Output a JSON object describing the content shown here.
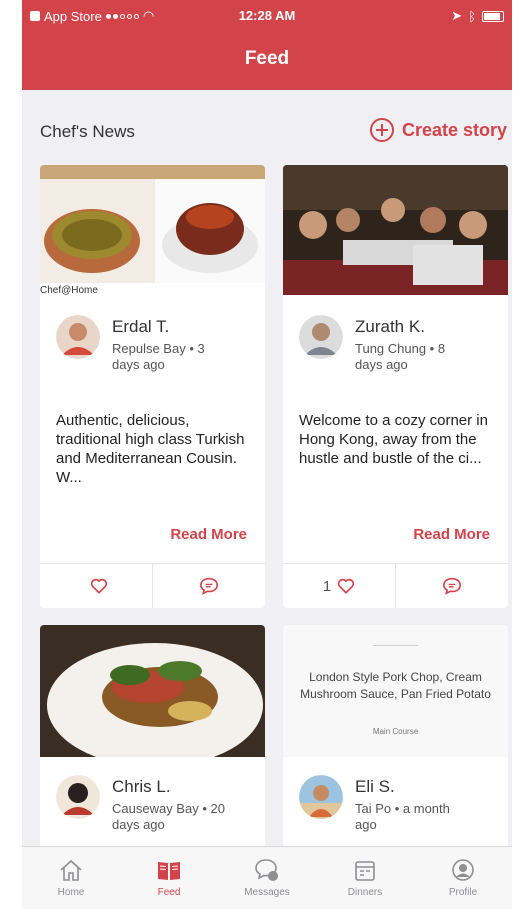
{
  "status_bar": {
    "carrier": "App Store",
    "time": "12:28 AM"
  },
  "header": {
    "title": "Feed"
  },
  "section": {
    "title": "Chef's News",
    "create_label": "Create story"
  },
  "cards": [
    {
      "author": "Erdal T.",
      "meta": "Repulse Bay • 3 days ago",
      "text": "Authentic, delicious, traditional high class Turkish and Mediterranean Cousin. W...",
      "photo_caption": "Chef@Home",
      "read_more": "Read More",
      "likes": ""
    },
    {
      "author": "Zurath K.",
      "meta": "Tung Chung • 8 days ago",
      "text": "Welcome to a cozy corner in Hong Kong, away from the hustle and bustle of the ci...",
      "read_more": "Read More",
      "likes": "1"
    },
    {
      "author": "Chris L.",
      "meta": "Causeway Bay • 20 days ago"
    },
    {
      "dish_title": "London Style Pork Chop, Cream Mushroom Sauce, Pan Fried Potato",
      "dish_course": "Main Course",
      "author": "Eli S.",
      "meta": "Tai Po • a month ago"
    }
  ],
  "tabs": [
    {
      "label": "Home",
      "icon": "home-icon"
    },
    {
      "label": "Feed",
      "icon": "book-icon"
    },
    {
      "label": "Messages",
      "icon": "chat-icon"
    },
    {
      "label": "Dinners",
      "icon": "calendar-icon"
    },
    {
      "label": "Profile",
      "icon": "profile-icon"
    }
  ],
  "colors": {
    "accent": "#d3434a",
    "background": "#efeff4"
  }
}
